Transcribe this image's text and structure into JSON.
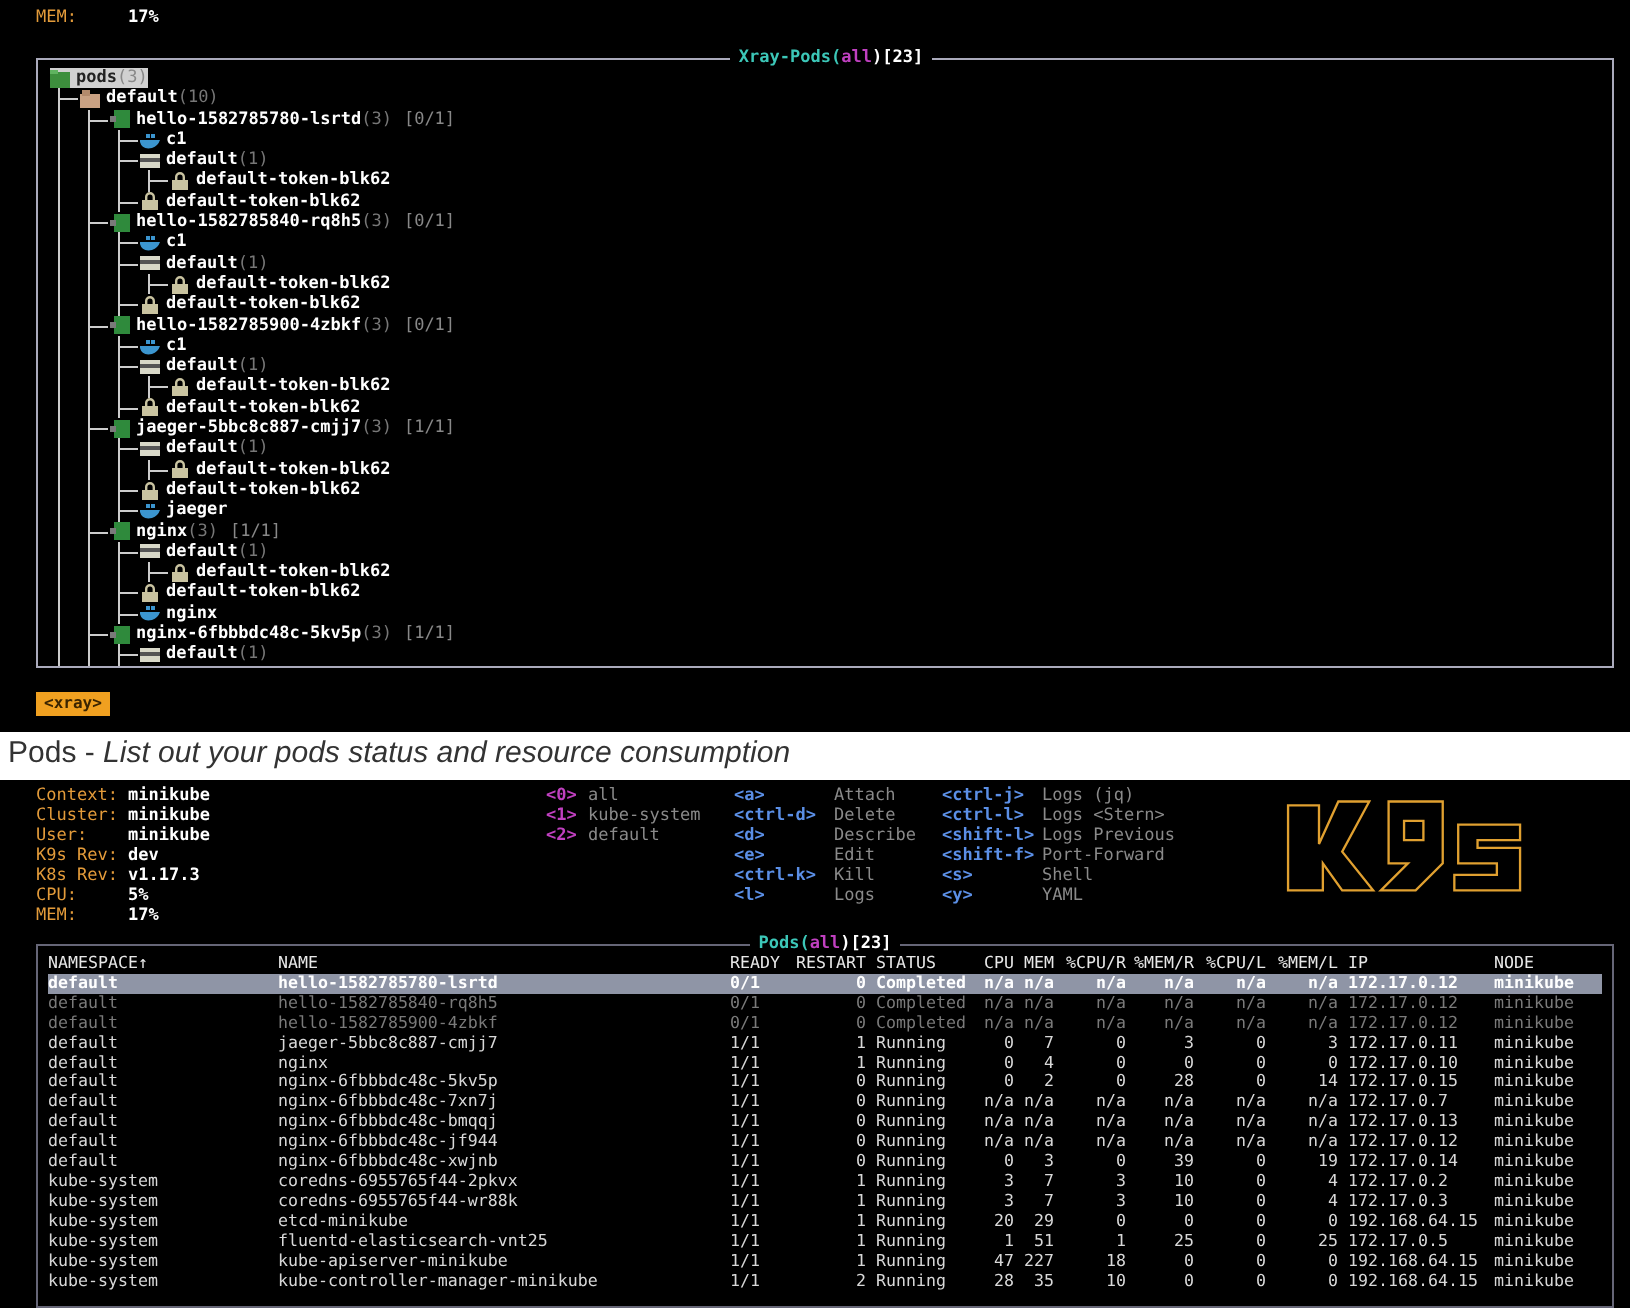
{
  "top_panel": {
    "cluster_info": [
      {
        "label": "MEM:",
        "value": "17%"
      }
    ],
    "title": {
      "name": "Xray-Pods(",
      "scope": "all",
      "count": ")[23]"
    },
    "tree": [
      {
        "kind": "pods",
        "name": "pods",
        "count": "(3)",
        "selected": true,
        "children": [
          {
            "kind": "namespace",
            "name": "default",
            "count": "(10)",
            "selected": false,
            "children": [
              {
                "kind": "pod",
                "name": "hello-1582785780-lsrtd",
                "count": "(3)",
                "status": "[0/1]",
                "selected": false,
                "children": [
                  {
                    "kind": "container",
                    "name": "c1",
                    "selected": false
                  },
                  {
                    "kind": "serviceaccount",
                    "name": "default",
                    "count": "(1)",
                    "selected": false,
                    "children": [
                      {
                        "kind": "secret",
                        "name": "default-token-blk62",
                        "selected": false
                      }
                    ]
                  },
                  {
                    "kind": "secret",
                    "name": "default-token-blk62",
                    "selected": false
                  }
                ]
              },
              {
                "kind": "pod",
                "name": "hello-1582785840-rq8h5",
                "count": "(3)",
                "status": "[0/1]",
                "selected": false,
                "children": [
                  {
                    "kind": "container",
                    "name": "c1",
                    "selected": false
                  },
                  {
                    "kind": "serviceaccount",
                    "name": "default",
                    "count": "(1)",
                    "selected": false,
                    "children": [
                      {
                        "kind": "secret",
                        "name": "default-token-blk62",
                        "selected": false
                      }
                    ]
                  },
                  {
                    "kind": "secret",
                    "name": "default-token-blk62",
                    "selected": false
                  }
                ]
              },
              {
                "kind": "pod",
                "name": "hello-1582785900-4zbkf",
                "count": "(3)",
                "status": "[0/1]",
                "selected": false,
                "children": [
                  {
                    "kind": "container",
                    "name": "c1",
                    "selected": false
                  },
                  {
                    "kind": "serviceaccount",
                    "name": "default",
                    "count": "(1)",
                    "selected": false,
                    "children": [
                      {
                        "kind": "secret",
                        "name": "default-token-blk62",
                        "selected": false
                      }
                    ]
                  },
                  {
                    "kind": "secret",
                    "name": "default-token-blk62",
                    "selected": false
                  }
                ]
              },
              {
                "kind": "pod",
                "name": "jaeger-5bbc8c887-cmjj7",
                "count": "(3)",
                "status": "[1/1]",
                "selected": false,
                "children": [
                  {
                    "kind": "serviceaccount",
                    "name": "default",
                    "count": "(1)",
                    "selected": false,
                    "children": [
                      {
                        "kind": "secret",
                        "name": "default-token-blk62",
                        "selected": false
                      }
                    ]
                  },
                  {
                    "kind": "secret",
                    "name": "default-token-blk62",
                    "selected": false
                  },
                  {
                    "kind": "container",
                    "name": "jaeger",
                    "selected": false
                  }
                ]
              },
              {
                "kind": "pod",
                "name": "nginx",
                "count": "(3)",
                "status": "[1/1]",
                "selected": false,
                "children": [
                  {
                    "kind": "serviceaccount",
                    "name": "default",
                    "count": "(1)",
                    "selected": false,
                    "children": [
                      {
                        "kind": "secret",
                        "name": "default-token-blk62",
                        "selected": false
                      }
                    ]
                  },
                  {
                    "kind": "secret",
                    "name": "default-token-blk62",
                    "selected": false
                  },
                  {
                    "kind": "container",
                    "name": "nginx",
                    "selected": false
                  }
                ]
              },
              {
                "kind": "pod",
                "name": "nginx-6fbbbdc48c-5kv5p",
                "count": "(3)",
                "status": "[1/1]",
                "selected": false,
                "children": [
                  {
                    "kind": "serviceaccount",
                    "name": "default",
                    "count": "(1)",
                    "selected": false
                  }
                ]
              }
            ]
          }
        ]
      }
    ],
    "footer_badge": "<xray>"
  },
  "caption": "Pods - *List out your pods status and resource consumption*",
  "bottom_panel": {
    "cluster_info": [
      {
        "label": "Context:",
        "value": "minikube"
      },
      {
        "label": "Cluster:",
        "value": "minikube"
      },
      {
        "label": "User:",
        "value": "minikube"
      },
      {
        "label": "K9s Rev:",
        "value": "dev"
      },
      {
        "label": "K8s Rev:",
        "value": "v1.17.3"
      },
      {
        "label": "CPU:",
        "value": "5%"
      },
      {
        "label": "MEM:",
        "value": "17%"
      }
    ],
    "namespaces": [
      {
        "key": "<0>",
        "label": "all"
      },
      {
        "key": "<1>",
        "label": "kube-system"
      },
      {
        "key": "<2>",
        "label": "default"
      }
    ],
    "hotkeys": [
      {
        "key": "<a>",
        "label": "Attach"
      },
      {
        "key": "<ctrl-d>",
        "label": "Delete"
      },
      {
        "key": "<d>",
        "label": "Describe"
      },
      {
        "key": "<e>",
        "label": "Edit"
      },
      {
        "key": "<ctrl-k>",
        "label": "Kill"
      },
      {
        "key": "<l>",
        "label": "Logs"
      },
      {
        "key": "<ctrl-j>",
        "label": "Logs (jq)"
      },
      {
        "key": "<ctrl-l>",
        "label": "Logs <Stern>"
      },
      {
        "key": "<shift-l>",
        "label": "Logs Previous"
      },
      {
        "key": "<shift-f>",
        "label": "Port-Forward"
      },
      {
        "key": "<s>",
        "label": "Shell"
      },
      {
        "key": "<y>",
        "label": "YAML"
      }
    ],
    "table": {
      "title": {
        "name": "Pods(",
        "scope": "all",
        "count": ")[23]"
      },
      "columns": [
        "NAMESPACE↑",
        "NAME",
        "READY",
        "RESTART",
        "STATUS",
        "CPU",
        "MEM",
        "%CPU/R",
        "%MEM/R",
        "%CPU/L",
        "%MEM/L",
        "IP",
        "NODE"
      ],
      "rows": [
        {
          "selected": true,
          "greyed": false,
          "cells": [
            "default",
            "hello-1582785780-lsrtd",
            "0/1",
            "0",
            "Completed",
            "n/a",
            "n/a",
            "n/a",
            "n/a",
            "n/a",
            "n/a",
            "172.17.0.12",
            "minikube"
          ]
        },
        {
          "selected": false,
          "greyed": true,
          "cells": [
            "default",
            "hello-1582785840-rq8h5",
            "0/1",
            "0",
            "Completed",
            "n/a",
            "n/a",
            "n/a",
            "n/a",
            "n/a",
            "n/a",
            "172.17.0.12",
            "minikube"
          ]
        },
        {
          "selected": false,
          "greyed": true,
          "cells": [
            "default",
            "hello-1582785900-4zbkf",
            "0/1",
            "0",
            "Completed",
            "n/a",
            "n/a",
            "n/a",
            "n/a",
            "n/a",
            "n/a",
            "172.17.0.12",
            "minikube"
          ]
        },
        {
          "selected": false,
          "greyed": false,
          "cells": [
            "default",
            "jaeger-5bbc8c887-cmjj7",
            "1/1",
            "1",
            "Running",
            "0",
            "7",
            "0",
            "3",
            "0",
            "3",
            "172.17.0.11",
            "minikube"
          ]
        },
        {
          "selected": false,
          "greyed": false,
          "cells": [
            "default",
            "nginx",
            "1/1",
            "1",
            "Running",
            "0",
            "4",
            "0",
            "0",
            "0",
            "0",
            "172.17.0.10",
            "minikube"
          ]
        },
        {
          "selected": false,
          "greyed": false,
          "cells": [
            "default",
            "nginx-6fbbbdc48c-5kv5p",
            "1/1",
            "0",
            "Running",
            "0",
            "2",
            "0",
            "28",
            "0",
            "14",
            "172.17.0.15",
            "minikube"
          ]
        },
        {
          "selected": false,
          "greyed": false,
          "cells": [
            "default",
            "nginx-6fbbbdc48c-7xn7j",
            "1/1",
            "0",
            "Running",
            "n/a",
            "n/a",
            "n/a",
            "n/a",
            "n/a",
            "n/a",
            "172.17.0.7",
            "minikube"
          ]
        },
        {
          "selected": false,
          "greyed": false,
          "cells": [
            "default",
            "nginx-6fbbbdc48c-bmqqj",
            "1/1",
            "0",
            "Running",
            "n/a",
            "n/a",
            "n/a",
            "n/a",
            "n/a",
            "n/a",
            "172.17.0.13",
            "minikube"
          ]
        },
        {
          "selected": false,
          "greyed": false,
          "cells": [
            "default",
            "nginx-6fbbbdc48c-jf944",
            "1/1",
            "0",
            "Running",
            "n/a",
            "n/a",
            "n/a",
            "n/a",
            "n/a",
            "n/a",
            "172.17.0.12",
            "minikube"
          ]
        },
        {
          "selected": false,
          "greyed": false,
          "cells": [
            "default",
            "nginx-6fbbbdc48c-xwjnb",
            "1/1",
            "0",
            "Running",
            "0",
            "3",
            "0",
            "39",
            "0",
            "19",
            "172.17.0.14",
            "minikube"
          ]
        },
        {
          "selected": false,
          "greyed": false,
          "cells": [
            "kube-system",
            "coredns-6955765f44-2pkvx",
            "1/1",
            "1",
            "Running",
            "3",
            "7",
            "3",
            "10",
            "0",
            "4",
            "172.17.0.2",
            "minikube"
          ]
        },
        {
          "selected": false,
          "greyed": false,
          "cells": [
            "kube-system",
            "coredns-6955765f44-wr88k",
            "1/1",
            "1",
            "Running",
            "3",
            "7",
            "3",
            "10",
            "0",
            "4",
            "172.17.0.3",
            "minikube"
          ]
        },
        {
          "selected": false,
          "greyed": false,
          "cells": [
            "kube-system",
            "etcd-minikube",
            "1/1",
            "1",
            "Running",
            "20",
            "29",
            "0",
            "0",
            "0",
            "0",
            "192.168.64.15",
            "minikube"
          ]
        },
        {
          "selected": false,
          "greyed": false,
          "cells": [
            "kube-system",
            "fluentd-elasticsearch-vnt25",
            "1/1",
            "1",
            "Running",
            "1",
            "51",
            "1",
            "25",
            "0",
            "25",
            "172.17.0.5",
            "minikube"
          ]
        },
        {
          "selected": false,
          "greyed": false,
          "cells": [
            "kube-system",
            "kube-apiserver-minikube",
            "1/1",
            "1",
            "Running",
            "47",
            "227",
            "18",
            "0",
            "0",
            "0",
            "192.168.64.15",
            "minikube"
          ]
        },
        {
          "selected": false,
          "greyed": false,
          "cells": [
            "kube-system",
            "kube-controller-manager-minikube",
            "1/1",
            "2",
            "Running",
            "28",
            "35",
            "10",
            "0",
            "0",
            "0",
            "192.168.64.15",
            "minikube"
          ]
        }
      ]
    }
  }
}
